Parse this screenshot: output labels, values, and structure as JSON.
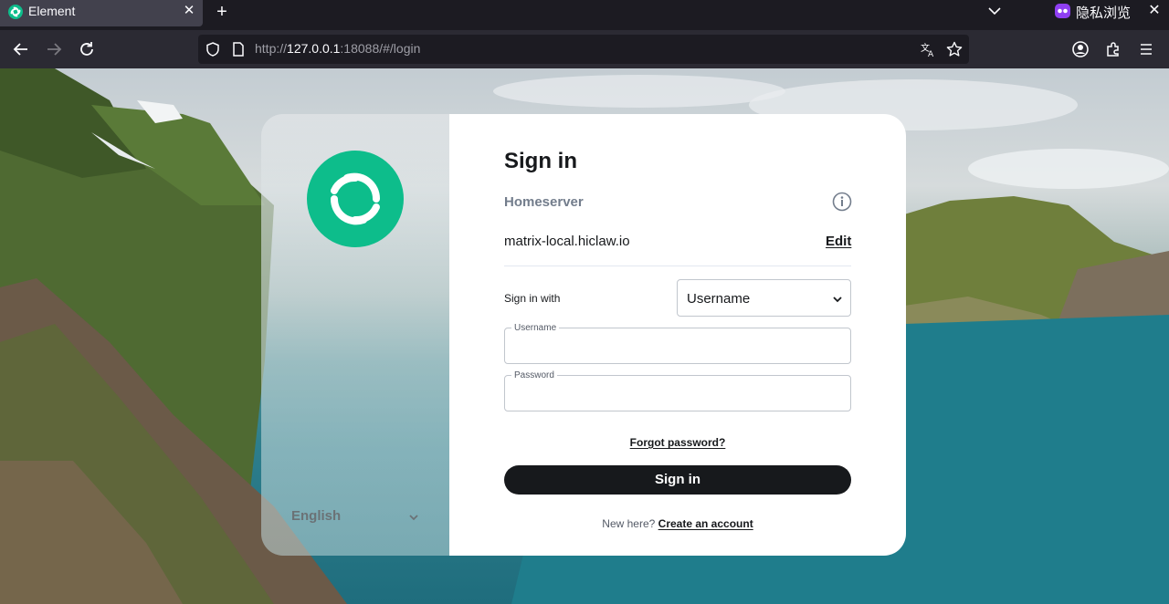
{
  "browser": {
    "tab": {
      "title": "Element",
      "close_glyph": "✕",
      "favicon": "element-icon"
    },
    "new_tab_glyph": "+",
    "private_label": "隐私浏览",
    "window_close_glyph": "✕",
    "url": {
      "scheme": "http://",
      "host": "127.0.0.1",
      "rest": ":18088/#/login"
    },
    "icons": [
      "back-icon",
      "forward-icon",
      "reload-icon",
      "shield-icon",
      "page-icon",
      "translate-icon",
      "star-icon",
      "account-icon",
      "extensions-icon",
      "menu-icon"
    ]
  },
  "aside": {
    "language": "English"
  },
  "login": {
    "title": "Sign in",
    "homeserver_label": "Homeserver",
    "homeserver_value": "matrix-local.hiclaw.io",
    "edit_label": "Edit",
    "sign_in_with_label": "Sign in with",
    "sign_in_method": "Username",
    "username_label": "Username",
    "username_value": "",
    "password_label": "Password",
    "password_value": "",
    "forgot_password": "Forgot password?",
    "submit": "Sign in",
    "signup_prompt": "New here?",
    "signup_link": "Create an account"
  },
  "colors": {
    "brand": "#0dbd8b",
    "button": "#17191c",
    "chrome_dark": "#1c1b22",
    "chrome_toolbar": "#2b2a33",
    "private_badge": "#8f3ff2"
  }
}
